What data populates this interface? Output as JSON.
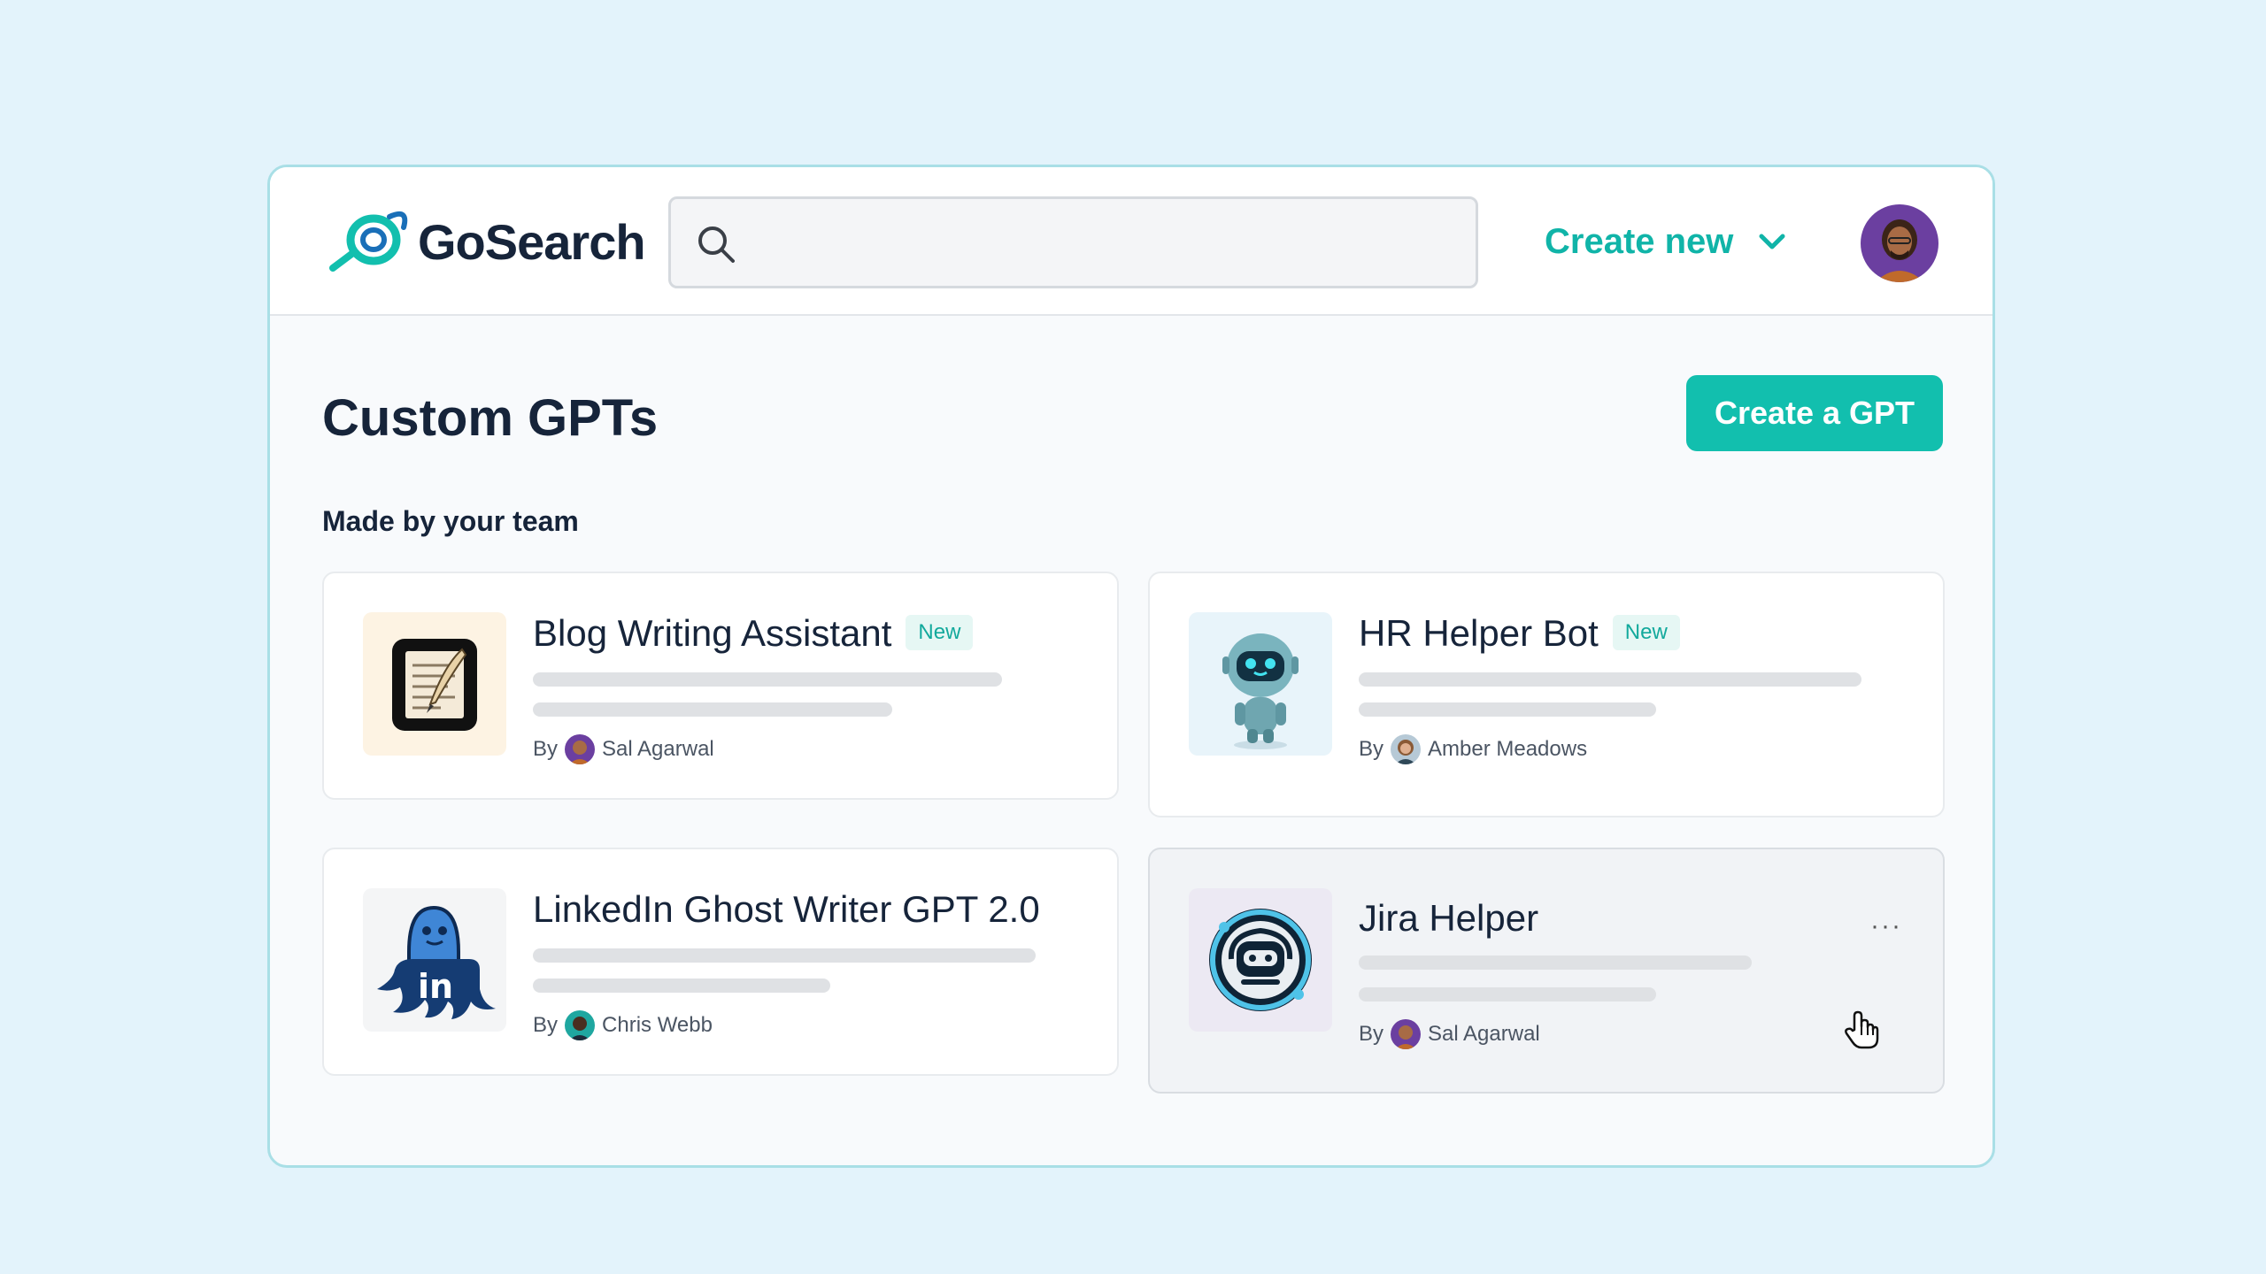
{
  "header": {
    "brand": "GoSearch",
    "search": {
      "value": "",
      "placeholder": ""
    },
    "create_new_label": "Create new",
    "colors": {
      "accent": "#12bfae",
      "brand_text": "#16243a"
    }
  },
  "main": {
    "title": "Custom GPTs",
    "create_gpt_label": "Create a GPT",
    "section_label": "Made by your team",
    "cards": [
      {
        "title": "Blog Writing Assistant",
        "badge": "New",
        "by": "By",
        "author": "Sal Agarwal",
        "icon": "quill-document-icon"
      },
      {
        "title": "HR Helper Bot",
        "badge": "New",
        "by": "By",
        "author": "Amber Meadows",
        "icon": "robot-icon"
      },
      {
        "title": "LinkedIn Ghost Writer GPT 2.0",
        "by": "By",
        "author": "Chris Webb",
        "icon": "linkedin-ghost-icon"
      },
      {
        "title": "Jira Helper",
        "by": "By",
        "author": "Sal Agarwal",
        "icon": "robot-badge-icon",
        "more": "···"
      }
    ]
  }
}
